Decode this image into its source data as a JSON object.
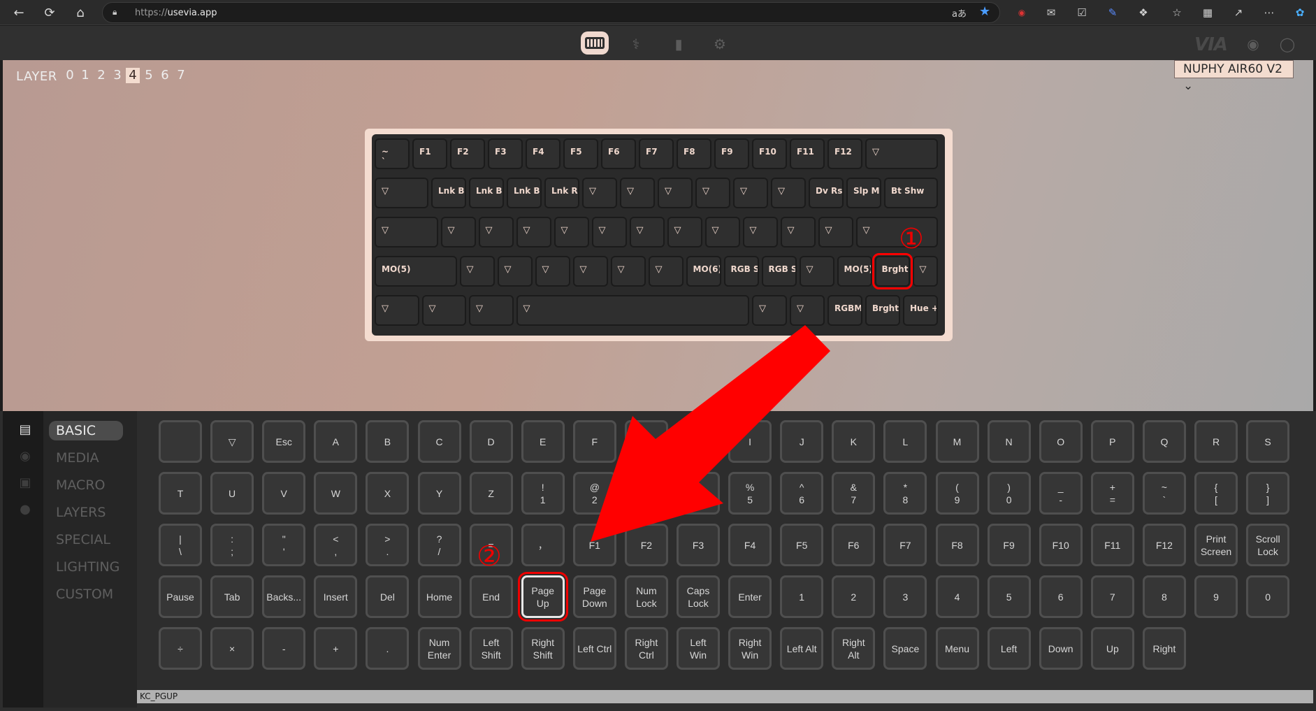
{
  "browser": {
    "url_prefix": "https://",
    "url_host": "usevia.app",
    "translate_label": "aあ"
  },
  "via": {
    "logo": "VIA"
  },
  "layer": {
    "label": "LAYER",
    "numbers": [
      "0",
      "1",
      "2",
      "3",
      "4",
      "5",
      "6",
      "7"
    ],
    "selected": "4"
  },
  "keyboard_select": {
    "value": "NUPHY AIR60 V2"
  },
  "keyboard_rows": [
    [
      "~\n`",
      "F1",
      "F2",
      "F3",
      "F4",
      "F5",
      "F6",
      "F7",
      "F8",
      "F9",
      "F10",
      "F11",
      "F12",
      "▽"
    ],
    [
      "▽",
      "Lnk BL",
      "Lnk BL",
      "Lnk BL",
      "Lnk RF",
      "▽",
      "▽",
      "▽",
      "▽",
      "▽",
      "▽",
      "Dv Rst",
      "Slp Mc",
      "Bt Shw"
    ],
    [
      "▽",
      "▽",
      "▽",
      "▽",
      "▽",
      "▽",
      "▽",
      "▽",
      "▽",
      "▽",
      "▽",
      "▽",
      "▽"
    ],
    [
      "MO(5)",
      "▽",
      "▽",
      "▽",
      "▽",
      "▽",
      "▽",
      "MO(6)",
      "RGB Sl",
      "RGB Sl",
      "▽",
      "MO(5)",
      "Brght+",
      "▽"
    ],
    [
      "▽",
      "▽",
      "▽",
      "▽",
      "▽",
      "▽",
      "RGBM(",
      "Brght-",
      "Hue +"
    ]
  ],
  "categories": [
    "BASIC",
    "MEDIA",
    "MACRO",
    "LAYERS",
    "SPECIAL",
    "LIGHTING",
    "CUSTOM"
  ],
  "selected_category": "BASIC",
  "basic_keys": [
    [
      "",
      "▽",
      "Esc",
      "A",
      "B",
      "C",
      "D",
      "E",
      "F",
      "G",
      "H",
      "I",
      "J",
      "K",
      "L",
      "M",
      "N",
      "O",
      "P",
      "Q",
      "R",
      "S"
    ],
    [
      "T",
      "U",
      "V",
      "W",
      "X",
      "Y",
      "Z",
      "!\n1",
      "@\n2",
      "#\n3",
      "$\n4",
      "%\n5",
      "^\n6",
      "&\n7",
      "*\n8",
      "(\n9",
      ")\n0",
      "_\n-",
      "+\n=",
      "~\n`",
      "{\n[",
      "}\n]"
    ],
    [
      "|\n\\",
      ":\n;",
      "\"\n'",
      "<\n,",
      ">\n.",
      "?\n/",
      "=",
      "，",
      "F1",
      "F2",
      "F3",
      "F4",
      "F5",
      "F6",
      "F7",
      "F8",
      "F9",
      "F10",
      "F11",
      "F12",
      "Print\nScreen",
      "Scroll\nLock"
    ],
    [
      "Pause",
      "Tab",
      "Backs...",
      "Insert",
      "Del",
      "Home",
      "End",
      "Page\nUp",
      "Page\nDown",
      "Num\nLock",
      "Caps\nLock",
      "Enter",
      "1",
      "2",
      "3",
      "4",
      "5",
      "6",
      "7",
      "8",
      "9",
      "0"
    ],
    [
      "÷",
      "×",
      "-",
      "+",
      ".",
      "Num\nEnter",
      "Left\nShift",
      "Right\nShift",
      "Left Ctrl",
      "Right\nCtrl",
      "Left\nWin",
      "Right\nWin",
      "Left Alt",
      "Right\nAlt",
      "Space",
      "Menu",
      "Left",
      "Down",
      "Up",
      "Right"
    ]
  ],
  "status": "KC_PGUP",
  "annotations": {
    "step1": "①",
    "step2": "②"
  }
}
